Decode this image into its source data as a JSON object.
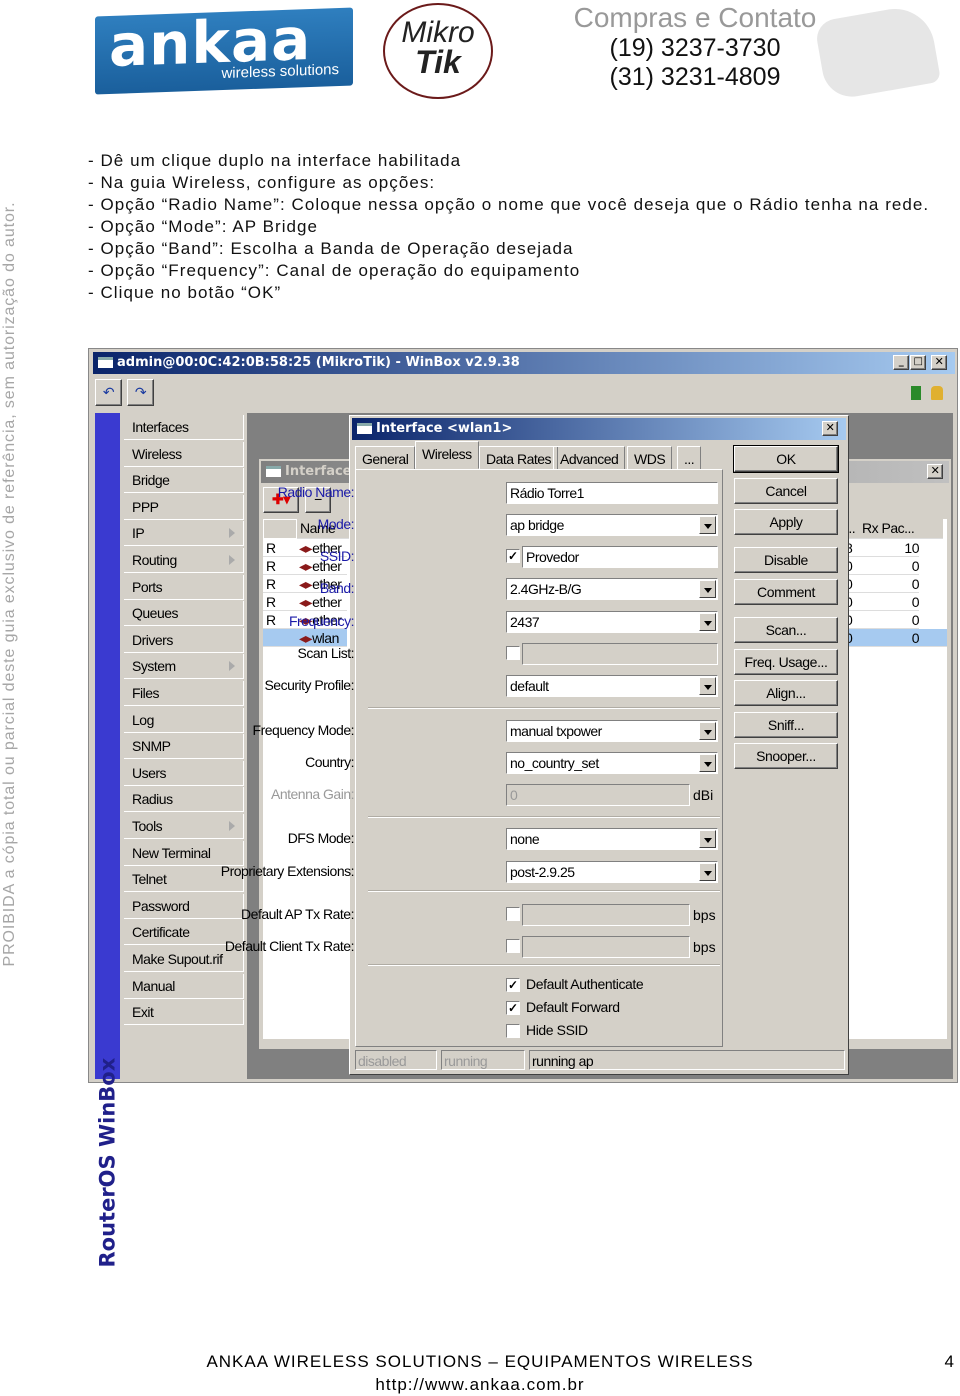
{
  "header": {
    "ankaa_logo": "ankaa",
    "ankaa_tagline": "wireless solutions",
    "mikrotik_logo": [
      "Mikro",
      "Tik"
    ],
    "contact_title": "Compras e Contato",
    "phones": [
      "(19) 3237-3730",
      "(31) 3231-4809"
    ]
  },
  "watermark": "PROIBIDA a cópia total ou parcial deste guia exclusivo de referência, sem autorização do autor.",
  "instructions": [
    "- Dê um clique duplo na interface habilitada",
    "- Na guia Wireless, configure as opções:",
    "- Opção “Radio Name”: Coloque nessa opção o nome que você deseja que o Rádio tenha na rede.",
    "- Opção “Mode”: AP Bridge",
    "- Opção “Band”: Escolha a Banda de Operação desejada",
    "- Opção “Frequency”: Canal de operação do equipamento",
    "- Clique no botão “OK”"
  ],
  "winbox": {
    "title": "admin@00:0C:42:0B:58:25 (MikroTik) - WinBox v2.9.38",
    "side_label": "RouterOS WinBox",
    "menu": [
      {
        "label": "Interfaces"
      },
      {
        "label": "Wireless"
      },
      {
        "label": "Bridge"
      },
      {
        "label": "PPP"
      },
      {
        "label": "IP",
        "submenu": true
      },
      {
        "label": "Routing",
        "submenu": true
      },
      {
        "label": "Ports"
      },
      {
        "label": "Queues"
      },
      {
        "label": "Drivers"
      },
      {
        "label": "System",
        "submenu": true
      },
      {
        "label": "Files"
      },
      {
        "label": "Log"
      },
      {
        "label": "SNMP"
      },
      {
        "label": "Users"
      },
      {
        "label": "Radius"
      },
      {
        "label": "Tools",
        "submenu": true
      },
      {
        "label": "New Terminal"
      },
      {
        "label": "Telnet"
      },
      {
        "label": "Password"
      },
      {
        "label": "Certificate"
      },
      {
        "label": "Make Supout.rif"
      },
      {
        "label": "Manual"
      },
      {
        "label": "Exit"
      }
    ],
    "interface_list": {
      "title": "Interface",
      "columns": [
        "",
        "Name",
        "...",
        "Rx Pac..."
      ],
      "rows": [
        {
          "flag": "R",
          "name": "ether",
          "c3": "8",
          "rx": "10"
        },
        {
          "flag": "R",
          "name": "ether",
          "c3": "0",
          "rx": "0"
        },
        {
          "flag": "R",
          "name": "ether",
          "c3": "0",
          "rx": "0"
        },
        {
          "flag": "R",
          "name": "ether",
          "c3": "0",
          "rx": "0"
        },
        {
          "flag": "R",
          "name": "ether",
          "c3": "0",
          "rx": "0"
        },
        {
          "flag": "",
          "name": "wlan",
          "c3": "0",
          "rx": "0",
          "selected": true
        }
      ]
    },
    "dialog": {
      "title": "Interface <wlan1>",
      "tabs": [
        "General",
        "Wireless",
        "Data Rates",
        "Advanced",
        "WDS",
        "..."
      ],
      "active_tab": "Wireless",
      "fields": [
        {
          "label": "Radio Name:",
          "value": "Rádio Torre1",
          "type": "text",
          "highlight": true
        },
        {
          "label": "Mode:",
          "value": "ap bridge",
          "type": "select",
          "highlight": true
        },
        {
          "label": "SSID:",
          "value": "Provedor",
          "type": "checktext",
          "checked": true,
          "highlight": true
        },
        {
          "label": "Band:",
          "value": "2.4GHz-B/G",
          "type": "select",
          "highlight": true
        },
        {
          "label": "Frequency:",
          "value": "2437",
          "type": "select",
          "highlight": true
        },
        {
          "label": "Scan List:",
          "value": "",
          "type": "checktext",
          "checked": false
        },
        {
          "label": "Security Profile:",
          "value": "default",
          "type": "select"
        },
        {
          "label": "Frequency Mode:",
          "value": "manual txpower",
          "type": "select"
        },
        {
          "label": "Country:",
          "value": "no_country_set",
          "type": "select"
        },
        {
          "label": "Antenna Gain:",
          "value": "0",
          "type": "disabled",
          "unit": "dBi"
        },
        {
          "label": "DFS Mode:",
          "value": "none",
          "type": "select"
        },
        {
          "label": "Proprietary Extensions:",
          "value": "post-2.9.25",
          "type": "select"
        },
        {
          "label": "Default AP Tx Rate:",
          "value": "",
          "type": "checkunit",
          "checked": false,
          "unit": "bps"
        },
        {
          "label": "Default Client Tx Rate:",
          "value": "",
          "type": "checkunit",
          "checked": false,
          "unit": "bps"
        }
      ],
      "checkboxes": [
        {
          "label": "Default Authenticate",
          "checked": true
        },
        {
          "label": "Default Forward",
          "checked": true
        },
        {
          "label": "Hide SSID",
          "checked": false
        }
      ],
      "buttons": [
        "OK",
        "Cancel",
        "Apply",
        "Disable",
        "Comment",
        "Scan...",
        "Freq. Usage...",
        "Align...",
        "Sniff...",
        "Snooper..."
      ],
      "status": [
        "disabled",
        "running",
        "running ap"
      ]
    }
  },
  "footer": {
    "company": "ANKAA WIRELESS SOLUTIONS – EQUIPAMENTOS WIRELESS",
    "page": "4",
    "url": "http://www.ankaa.com.br"
  }
}
